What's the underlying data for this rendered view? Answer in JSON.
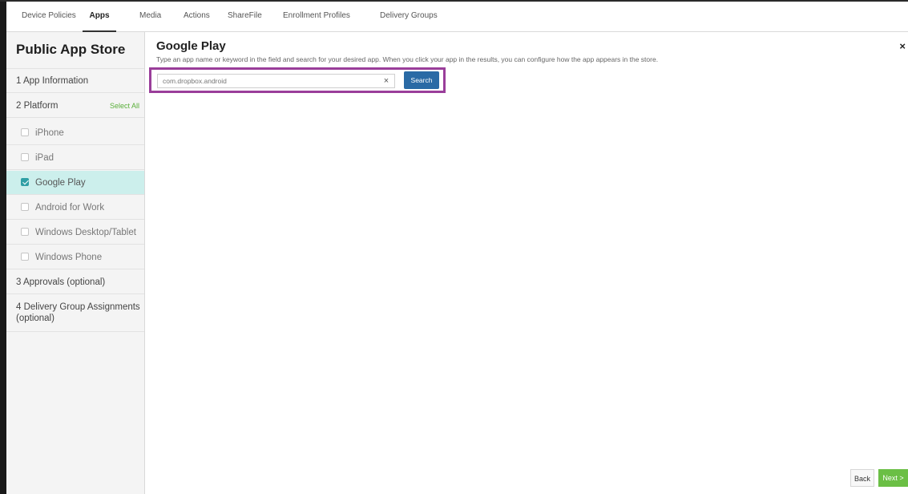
{
  "top_tabs": [
    {
      "label": "Device Policies"
    },
    {
      "label": "Apps"
    },
    {
      "label": "Media"
    },
    {
      "label": "Actions"
    },
    {
      "label": "ShareFile"
    },
    {
      "label": "Enrollment Profiles"
    },
    {
      "label": "Delivery Groups"
    }
  ],
  "sidebar": {
    "heading": "Public App Store",
    "step1": "1  App Information",
    "step2": "2  Platform",
    "select_all": "Select All",
    "platforms": [
      {
        "label": "iPhone",
        "checked": false
      },
      {
        "label": "iPad",
        "checked": false
      },
      {
        "label": "Google Play",
        "checked": true
      },
      {
        "label": "Android for Work",
        "checked": false
      },
      {
        "label": "Windows Desktop/Tablet",
        "checked": false
      },
      {
        "label": "Windows Phone",
        "checked": false
      }
    ],
    "step3": "3  Approvals (optional)",
    "step4": "4  Delivery Group Assignments (optional)"
  },
  "main": {
    "title": "Google Play",
    "description": "Type an app name or keyword in the field and search for your desired app. When you click your app in the results, you can configure how the app appears in the store.",
    "close_icon": "×",
    "search_value": "com.dropbox.android",
    "clear_icon": "×",
    "search_label": "Search"
  },
  "footer": {
    "back_label": "Back",
    "next_label": "Next >"
  },
  "colors": {
    "accent_blue": "#2a6aa5",
    "next_green": "#6bbf45",
    "active_row": "#ccefec",
    "highlight_purple": "#9a3e9a"
  }
}
